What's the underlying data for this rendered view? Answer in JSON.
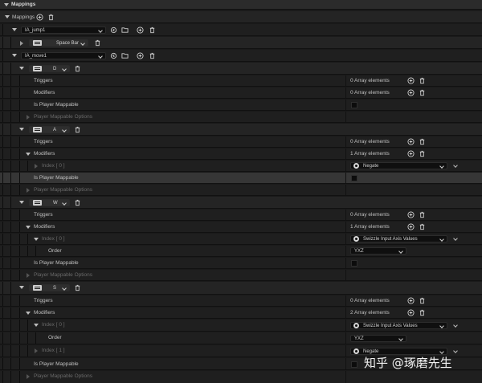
{
  "header": {
    "title": "Mappings"
  },
  "mappings_label": "Mappings",
  "jump": {
    "action": "IA_jump1",
    "key": "Space Bar"
  },
  "move": {
    "action": "IA_move1",
    "keys": {
      "d": {
        "key": "D",
        "triggers": "Triggers",
        "triggers_value": "0 Array elements",
        "modifiers": "Modifiers",
        "modifiers_value": "0 Array elements",
        "player_mappable": "Is Player Mappable",
        "options": "Player Mappable Options"
      },
      "a": {
        "key": "A",
        "triggers": "Triggers",
        "triggers_value": "0 Array elements",
        "modifiers": "Modifiers",
        "modifiers_value": "1 Array elements",
        "index0": "Index [ 0 ]",
        "index0_value": "Negate",
        "player_mappable": "Is Player Mappable",
        "options": "Player Mappable Options"
      },
      "w": {
        "key": "W",
        "triggers": "Triggers",
        "triggers_value": "0 Array elements",
        "modifiers": "Modifiers",
        "modifiers_value": "1 Array elements",
        "index0": "Index [ 0 ]",
        "index0_value": "Swizzle Input Axis Values",
        "order": "Order",
        "order_value": "YXZ",
        "player_mappable": "Is Player Mappable",
        "options": "Player Mappable Options"
      },
      "s": {
        "key": "S",
        "triggers": "Triggers",
        "triggers_value": "0 Array elements",
        "modifiers": "Modifiers",
        "modifiers_value": "2 Array elements",
        "index0": "Index [ 0 ]",
        "index0_value": "Swizzle Input Axis Values",
        "order": "Order",
        "order_value": "YXZ",
        "index1": "Index [ 1 ]",
        "index1_value": "Negate",
        "player_mappable": "Is Player Mappable",
        "options": "Player Mappable Options"
      }
    }
  },
  "watermark": "知乎 @琢磨先生",
  "colors": {
    "background": "#1a1a1a",
    "header": "#2b2b2b",
    "row": "#242424",
    "row_alt": "#1f1f1f",
    "highlight": "#363636",
    "text": "#c0c0c0",
    "dim_text": "#6a6a6a"
  }
}
